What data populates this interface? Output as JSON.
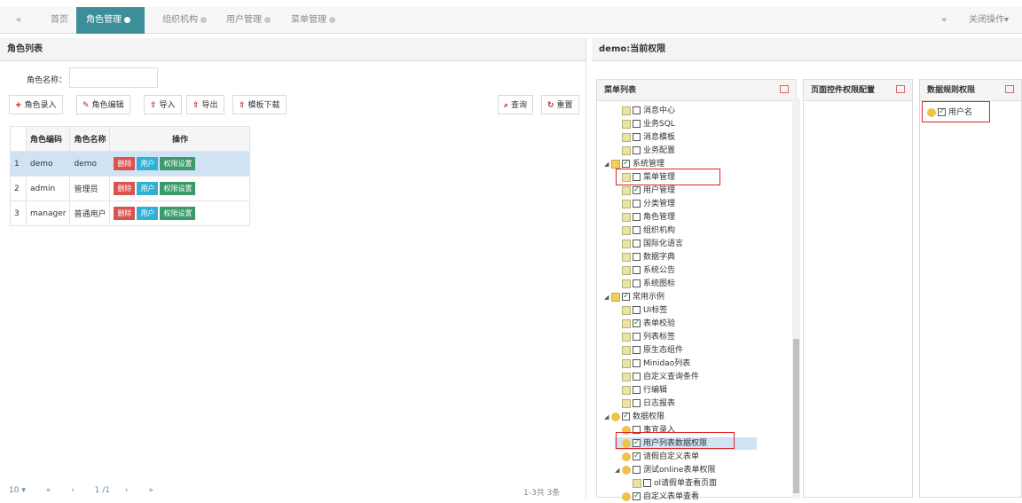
{
  "tabs": {
    "back_icon": "«",
    "home": "首页",
    "role": "角色管理",
    "org": "组织机构",
    "user": "用户管理",
    "menu": "菜单管理",
    "forward_icon": "»",
    "close_ops": "关闭操作",
    "close_ops_caret": "▾"
  },
  "left": {
    "title": "角色列表",
    "search_label": "角色名称：",
    "search_value": "",
    "buttons": {
      "add": "角色录入",
      "edit": "角色编辑",
      "import": "导入",
      "export": "导出",
      "template": "模板下载",
      "query": "查询",
      "reset": "重置"
    },
    "table": {
      "headers": [
        "角色编码",
        "角色名称",
        "操作"
      ],
      "rows": [
        {
          "num": "1",
          "code": "demo",
          "name": "demo",
          "selected": true
        },
        {
          "num": "2",
          "code": "admin",
          "name": "管理员",
          "selected": false
        },
        {
          "num": "3",
          "code": "manager",
          "name": "普通用户",
          "selected": false
        }
      ],
      "actions": {
        "delete": "删除",
        "user": "用户",
        "perm": "权限设置"
      }
    },
    "pager": {
      "size": "10 ▾",
      "first": "«",
      "prev": "‹",
      "page": "1",
      "of": "/1",
      "next": "›",
      "last": "»",
      "summary": "1-3共 3条"
    }
  },
  "right": {
    "title": "demo:当前权限",
    "col_menu": "菜单列表",
    "col_page": "页面控件权限配置",
    "col_data": "数据规则权限",
    "data_rule_item": "用户名",
    "tree": [
      {
        "label": "消息中心",
        "level": 2,
        "type": "doc",
        "checked": false
      },
      {
        "label": "业务SQL",
        "level": 2,
        "type": "doc",
        "checked": false
      },
      {
        "label": "消息模板",
        "level": 2,
        "type": "doc",
        "checked": false
      },
      {
        "label": "业务配置",
        "level": 2,
        "type": "doc",
        "checked": false
      },
      {
        "label": "系统管理",
        "level": 1,
        "type": "folder",
        "checked": true
      },
      {
        "label": "菜单管理",
        "level": 2,
        "type": "doc",
        "checked": false
      },
      {
        "label": "用户管理",
        "level": 2,
        "type": "doc",
        "checked": true
      },
      {
        "label": "分类管理",
        "level": 2,
        "type": "doc",
        "checked": false
      },
      {
        "label": "角色管理",
        "level": 2,
        "type": "doc",
        "checked": false
      },
      {
        "label": "组织机构",
        "level": 2,
        "type": "doc",
        "checked": false
      },
      {
        "label": "国际化语言",
        "level": 2,
        "type": "doc",
        "checked": false
      },
      {
        "label": "数据字典",
        "level": 2,
        "type": "doc",
        "checked": false
      },
      {
        "label": "系统公告",
        "level": 2,
        "type": "doc",
        "checked": false
      },
      {
        "label": "系统图标",
        "level": 2,
        "type": "doc",
        "checked": false
      },
      {
        "label": "常用示例",
        "level": 1,
        "type": "folder",
        "checked": true
      },
      {
        "label": "UI标签",
        "level": 2,
        "type": "doc",
        "checked": false
      },
      {
        "label": "表单校验",
        "level": 2,
        "type": "doc",
        "checked": true
      },
      {
        "label": "列表标签",
        "level": 2,
        "type": "doc",
        "checked": false
      },
      {
        "label": "原生态组件",
        "level": 2,
        "type": "doc",
        "checked": false
      },
      {
        "label": "Minidao列表",
        "level": 2,
        "type": "doc",
        "checked": false
      },
      {
        "label": "自定义查询条件",
        "level": 2,
        "type": "doc",
        "checked": false
      },
      {
        "label": "行编辑",
        "level": 2,
        "type": "doc",
        "checked": false
      },
      {
        "label": "日志报表",
        "level": 2,
        "type": "doc",
        "checked": false
      },
      {
        "label": "数据权限",
        "level": 1,
        "type": "key",
        "checked": true
      },
      {
        "label": "事宜录入",
        "level": 2,
        "type": "key",
        "checked": false
      },
      {
        "label": "用户列表数据权限",
        "level": 2,
        "type": "key",
        "checked": true
      },
      {
        "label": "请假自定义表单",
        "level": 2,
        "type": "key",
        "checked": true
      },
      {
        "label": "测试online表单权限",
        "level": 2,
        "type": "key",
        "checked": false
      },
      {
        "label": "ol请假单查看页面",
        "level": 3,
        "type": "doc",
        "checked": false
      },
      {
        "label": "自定义表单查看",
        "level": 2,
        "type": "key",
        "checked": true
      }
    ]
  },
  "colors": {
    "active_tab": "#3b8e9a",
    "delete": "#d9534f",
    "user": "#31b0d5",
    "perm": "#3c9a6a",
    "highlight": "#e02424"
  }
}
